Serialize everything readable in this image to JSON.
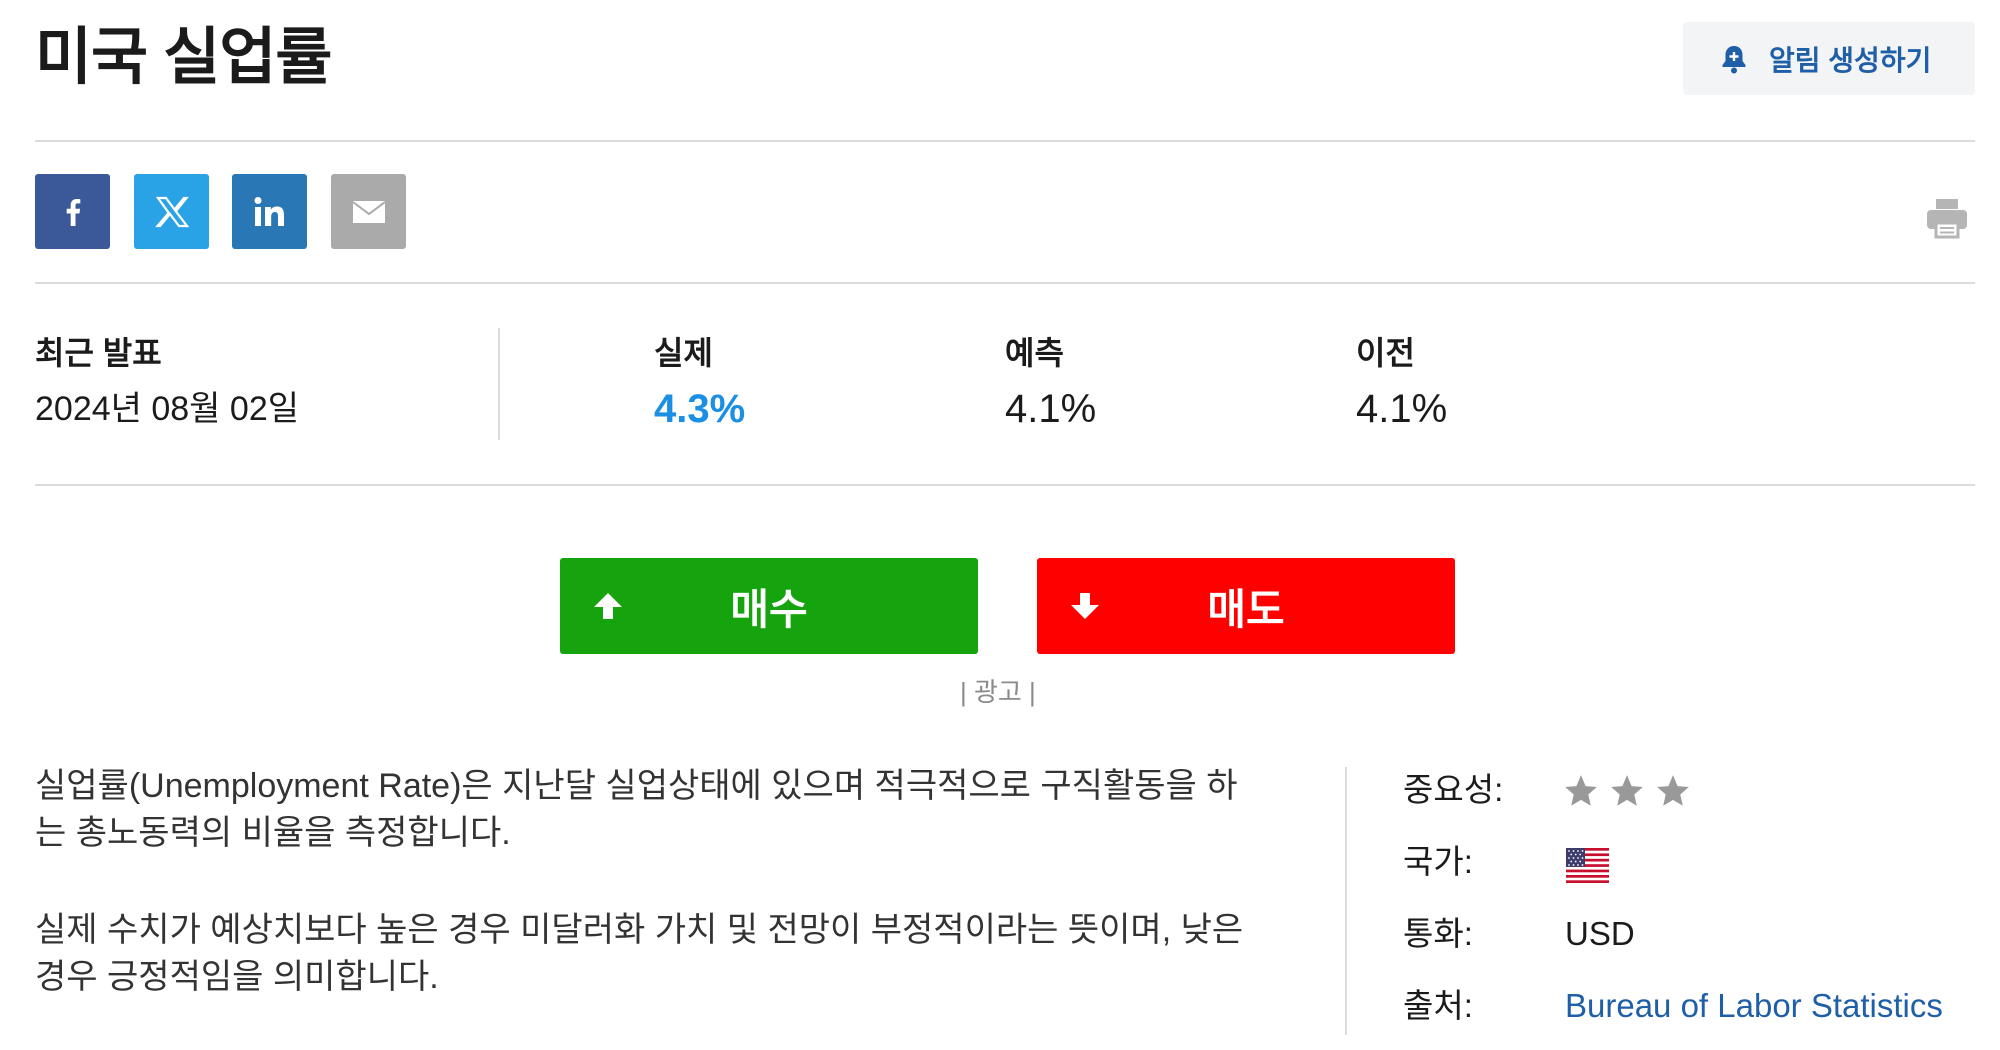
{
  "header": {
    "title": "미국 실업률",
    "alert_button_label": "알림 생성하기",
    "alert_icon": "bell-icon"
  },
  "share": {
    "icons": [
      "facebook-icon",
      "x-icon",
      "linkedin-icon",
      "email-icon"
    ],
    "print_icon": "printer-icon"
  },
  "latest_release": {
    "label": "최근 발표",
    "date": "2024년 08월 02일"
  },
  "metrics": [
    {
      "label": "실제",
      "value": "4.3%",
      "highlight_color": "#1a8fe3"
    },
    {
      "label": "예측",
      "value": "4.1%"
    },
    {
      "label": "이전",
      "value": "4.1%"
    }
  ],
  "trade": {
    "buy_label": "매수",
    "sell_label": "매도",
    "buy_color": "#16a40e",
    "sell_color": "#ff0000",
    "ad_label": "| 광고 |"
  },
  "description": [
    "실업률(Unemployment Rate)은 지난달 실업상태에 있으며 적극적으로 구직활동을 하는 총노동력의 비율을 측정합니다.",
    "실제 수치가 예상치보다 높은 경우 미달러화 가치 및 전망이 부정적이라는 뜻이며, 낮은 경우 긍정적임을 의미합니다."
  ],
  "details": {
    "importance_label": "중요성:",
    "importance_stars": 3,
    "importance_max": 3,
    "country_label": "국가:",
    "country_flag": "us-flag-icon",
    "currency_label": "통화:",
    "currency_value": "USD",
    "source_label": "출처:",
    "source_value": "Bureau of Labor Statistics"
  }
}
